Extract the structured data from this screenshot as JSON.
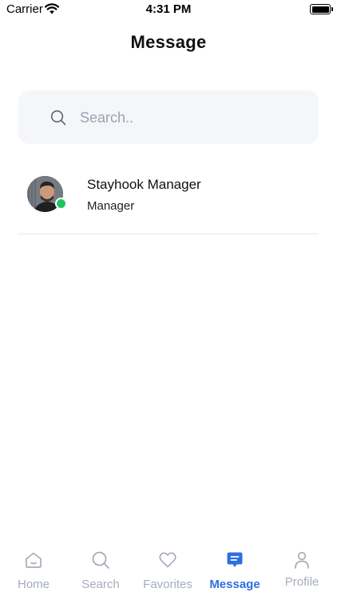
{
  "status_bar": {
    "carrier": "Carrier",
    "time": "4:31 PM"
  },
  "page": {
    "title": "Message"
  },
  "search": {
    "placeholder": "Search.."
  },
  "conversations": [
    {
      "name": "Stayhook Manager",
      "subtitle": "Manager",
      "online": true
    }
  ],
  "tabs": [
    {
      "label": "Home",
      "icon": "home-icon",
      "active": false
    },
    {
      "label": "Search",
      "icon": "search-icon",
      "active": false
    },
    {
      "label": "Favorites",
      "icon": "heart-icon",
      "active": false
    },
    {
      "label": "Message",
      "icon": "message-icon",
      "active": true
    },
    {
      "label": "Profile",
      "icon": "person-icon",
      "active": false
    }
  ],
  "colors": {
    "accent": "#2f6fe0",
    "inactive": "#a5adbb",
    "online": "#22c35e",
    "search_bg": "#f4f6f9"
  }
}
